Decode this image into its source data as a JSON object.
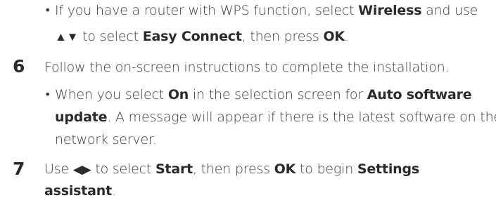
{
  "bullet1": {
    "line1": {
      "a": "If you have a router with WPS function, select ",
      "b": "Wireless",
      "c": " and use"
    },
    "line2": {
      "arrows": "▲▼",
      "a": " to select ",
      "b": "Easy Connect",
      "c": ", then press ",
      "d": "OK",
      "e": "."
    }
  },
  "step6": {
    "number": "6",
    "text": "Follow the on-screen instructions to complete the installation.",
    "bullet": {
      "line1": {
        "a": "When you select ",
        "b": "On",
        "c": " in the selection screen for ",
        "d": "Auto software"
      },
      "line2": {
        "a": "update",
        "b": ". A message will appear if there is the latest software on the"
      },
      "line3": "network server."
    }
  },
  "step7": {
    "number": "7",
    "line1": {
      "a": "Use ",
      "arrows": "◀▶",
      "b": " to select ",
      "c": "Start",
      "d": ", then press ",
      "e": "OK",
      "f": " to begin ",
      "g": "Settings"
    },
    "line2": {
      "a": "assistant",
      "b": "."
    }
  }
}
